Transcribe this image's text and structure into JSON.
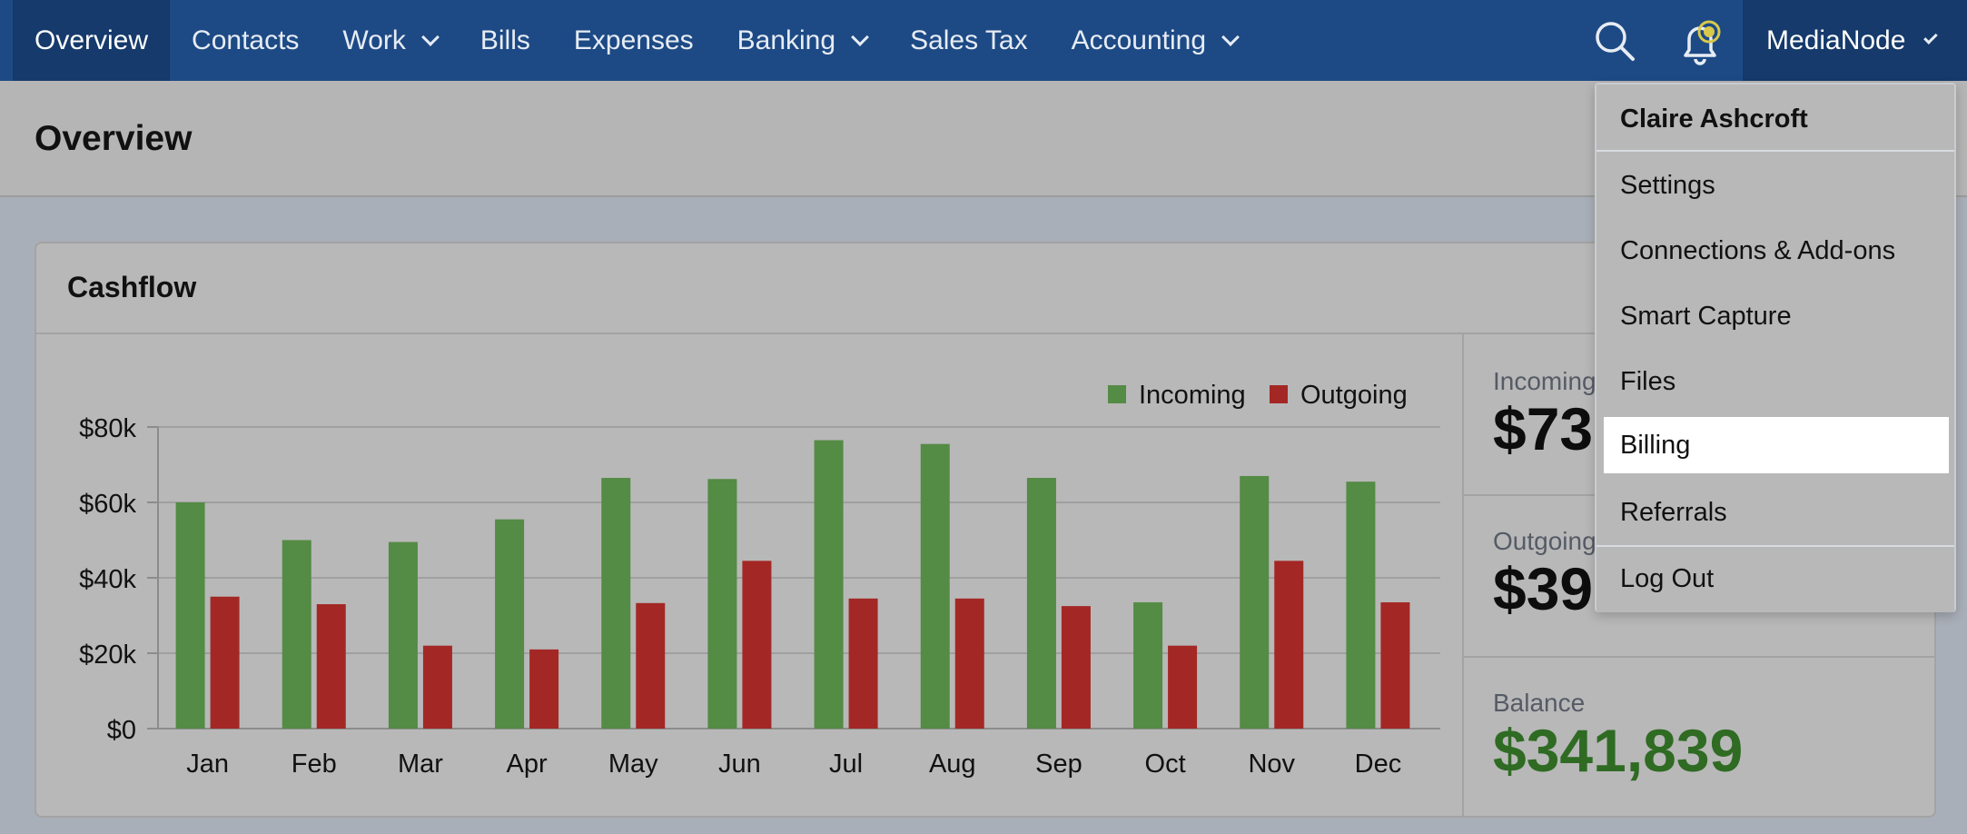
{
  "nav": {
    "items": [
      {
        "label": "Overview",
        "dropdown": false,
        "active": true
      },
      {
        "label": "Contacts",
        "dropdown": false
      },
      {
        "label": "Work",
        "dropdown": true
      },
      {
        "label": "Bills",
        "dropdown": false
      },
      {
        "label": "Expenses",
        "dropdown": false
      },
      {
        "label": "Banking",
        "dropdown": true
      },
      {
        "label": "Sales Tax",
        "dropdown": false
      },
      {
        "label": "Accounting",
        "dropdown": true
      }
    ],
    "account_label": "MediaNode",
    "icons": [
      "search-icon",
      "bell-icon"
    ],
    "accent": "#1d4a85"
  },
  "page": {
    "title": "Overview"
  },
  "cashflow": {
    "title": "Cashflow",
    "stats": [
      {
        "label": "Incoming",
        "value": "$73"
      },
      {
        "label": "Outgoing",
        "value": "$39"
      },
      {
        "label": "Balance",
        "value": "$341,839"
      }
    ]
  },
  "chart_data": {
    "type": "bar",
    "categories": [
      "Jan",
      "Feb",
      "Mar",
      "Apr",
      "May",
      "Jun",
      "Jul",
      "Aug",
      "Sep",
      "Oct",
      "Nov",
      "Dec"
    ],
    "series": [
      {
        "name": "Incoming",
        "color": "#548b45",
        "values": [
          60000,
          50000,
          49500,
          55500,
          66500,
          66200,
          76500,
          75500,
          66500,
          33500,
          67000,
          65500
        ]
      },
      {
        "name": "Outgoing",
        "color": "#a32825",
        "values": [
          35000,
          33000,
          22000,
          21000,
          33300,
          44500,
          34500,
          34500,
          32500,
          22000,
          44500,
          33500
        ]
      }
    ],
    "yticks": [
      "$0",
      "$20k",
      "$40k",
      "$60k",
      "$80k"
    ],
    "ylim": [
      0,
      80000
    ],
    "legend": "top-right",
    "grid": true
  },
  "dropdown": {
    "user_name": "Claire Ashcroft",
    "items": [
      "Settings",
      "Connections & Add-ons",
      "Smart Capture",
      "Files",
      "Billing",
      "Referrals"
    ],
    "logout": "Log Out",
    "highlighted": "Billing"
  }
}
